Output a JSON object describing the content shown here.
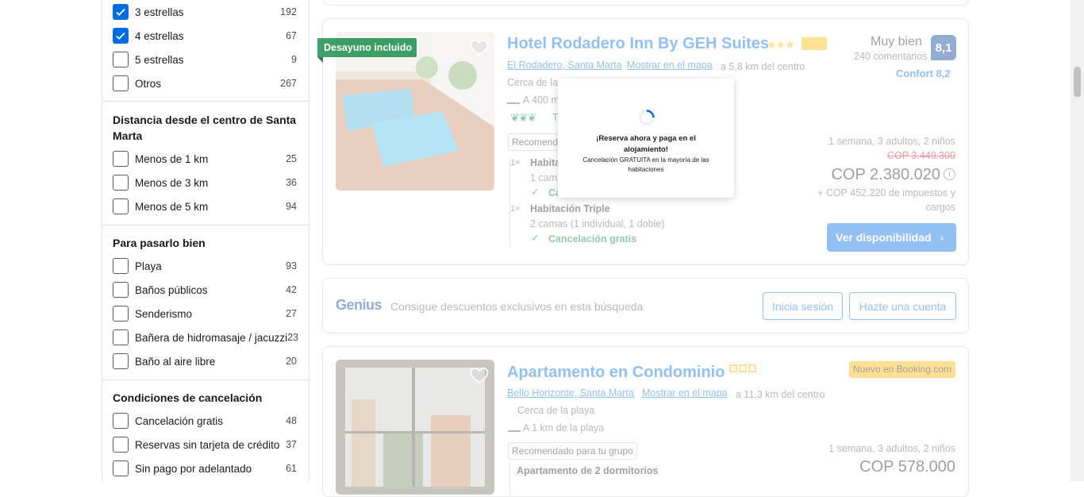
{
  "sidebar": {
    "stars": [
      {
        "label": "3 estrellas",
        "count": "192",
        "checked": true
      },
      {
        "label": "4 estrellas",
        "count": "67",
        "checked": true
      },
      {
        "label": "5 estrellas",
        "count": "9",
        "checked": false
      },
      {
        "label": "Otros",
        "count": "267",
        "checked": false
      }
    ],
    "distance": {
      "title": "Distancia desde el centro de Santa Marta",
      "items": [
        {
          "label": "Menos de 1 km",
          "count": "25"
        },
        {
          "label": "Menos de 3 km",
          "count": "36"
        },
        {
          "label": "Menos de 5 km",
          "count": "94"
        }
      ]
    },
    "fun": {
      "title": "Para pasarlo bien",
      "items": [
        {
          "label": "Playa",
          "count": "93"
        },
        {
          "label": "Baños públicos",
          "count": "42"
        },
        {
          "label": "Senderismo",
          "count": "27"
        },
        {
          "label": "Bañera de hidromasaje / jacuzzi",
          "count": "23"
        },
        {
          "label": "Baño al aire libre",
          "count": "20"
        }
      ]
    },
    "cancel": {
      "title": "Condiciones de cancelación",
      "items": [
        {
          "label": "Cancelación gratis",
          "count": "48"
        },
        {
          "label": "Reservas sin tarjeta de crédito",
          "count": "37"
        },
        {
          "label": "Sin pago por adelantado",
          "count": "61"
        }
      ]
    }
  },
  "hotel1": {
    "badge": "Desayuno incluido",
    "name": "Hotel Rodadero Inn By GEH Suites",
    "location": "El Rodadero, Santa Marta",
    "map_link": "Mostrar en el mapa",
    "distance": "a 5,8 km del centro",
    "near": "Cerca de la playa",
    "beach": "A 400 m de la playa",
    "sustainable": "Travel Sustainable",
    "recommended": "Recomendado para tu grupo",
    "rooms": [
      {
        "qty": "1×",
        "name": "Habitación Doble",
        "beds": "1 cama doble",
        "cancel": "Cancelación gratis"
      },
      {
        "qty": "1×",
        "name": "Habitación Triple",
        "beds": "2 camas (1 individual, 1 doble)",
        "cancel": "Cancelación gratis"
      }
    ],
    "rating_word": "Muy bien",
    "reviews": "240 comentarios",
    "score": "8,1",
    "comfort": "Confort 8,2",
    "stay": "1 semana, 3 adultos, 2 niños",
    "old_price": "COP 3.449.300",
    "price": "COP 2.380.020",
    "taxes_line1": "+ COP 452.220 de impuestos y",
    "taxes_line2": "cargos",
    "cta": "Ver disponibilidad"
  },
  "popup": {
    "title": "¡Reserva ahora y paga en el alojamiento!",
    "subtitle": "Cancelación GRATUITA en la mayoría de las habitaciones"
  },
  "genius": {
    "logo": "Genius",
    "text": "Consigue descuentos exclusivos en esta búsqueda",
    "signin": "Inicia sesión",
    "create": "Hazte una cuenta"
  },
  "hotel2": {
    "name": "Apartamento en Condominio",
    "new_badge": "Nuevo en Booking.com",
    "location": "Bello Horizonte, Santa Marta",
    "map_link": "Mostrar en el mapa",
    "distance": "a 11,3 km del centro",
    "near": "Cerca de la playa",
    "beach": "A 1 km de la playa",
    "recommended": "Recomendado para tu grupo",
    "stay": "1 semana, 3 adultos, 2 niños",
    "price": "COP 578.000",
    "unit": "Apartamento de 2 dormitorios"
  },
  "colors": {
    "accent": "#006ce4",
    "badge_green": "#008234",
    "score_bg": "#003b95",
    "new_badge_bg": "#ffb700"
  }
}
